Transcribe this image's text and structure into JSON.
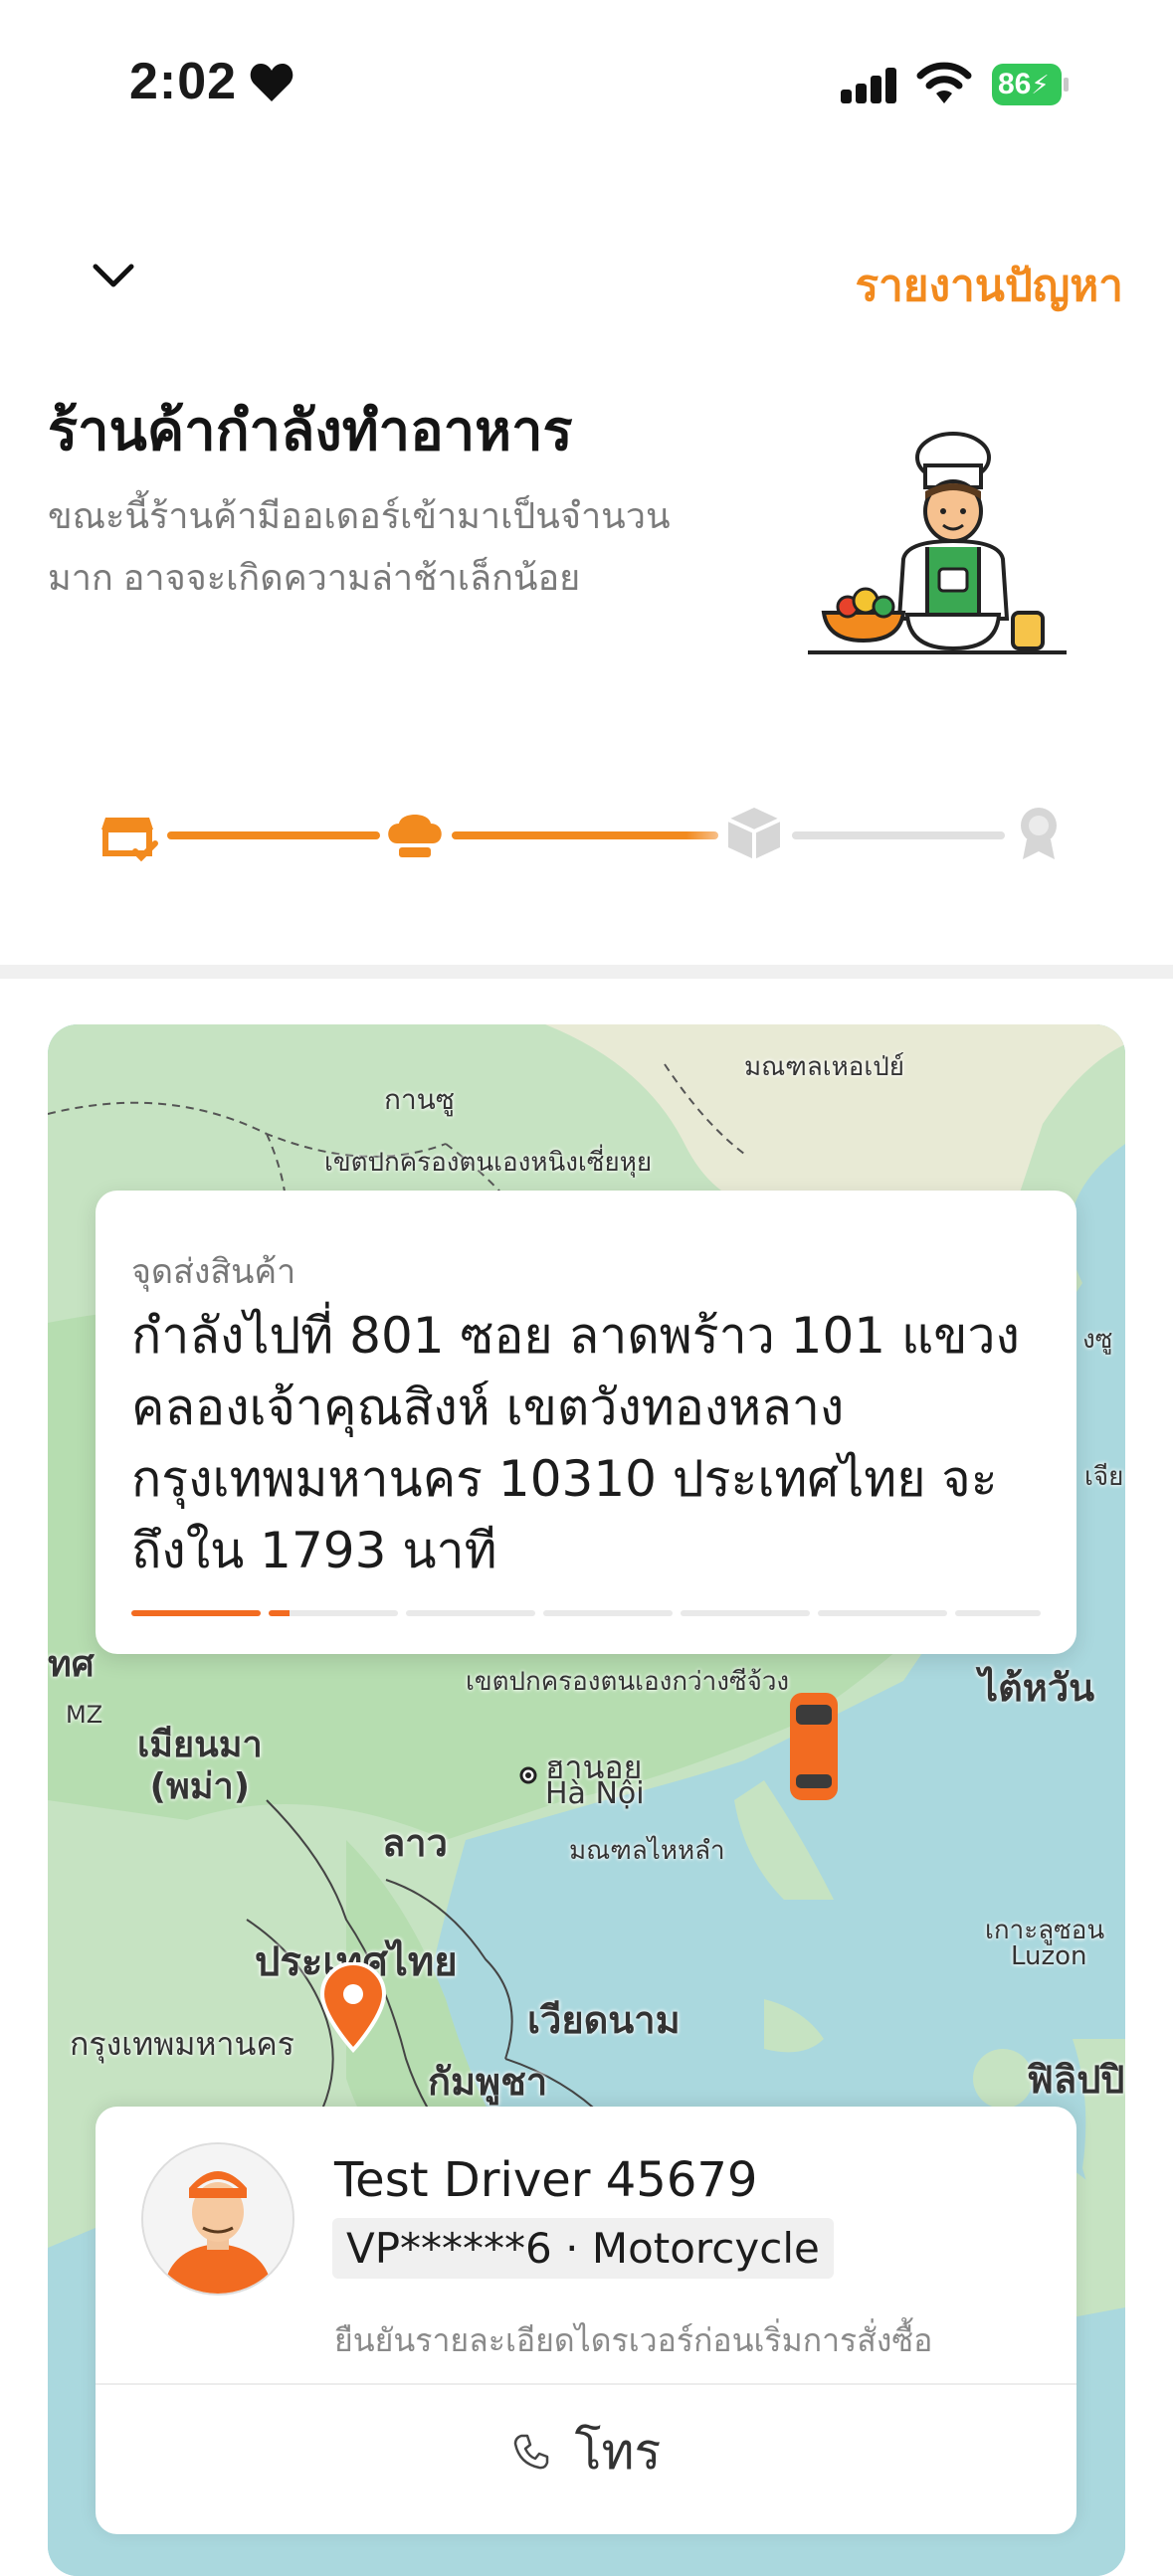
{
  "status_bar": {
    "time": "2:02",
    "battery": "86"
  },
  "header": {
    "report_label": "รายงานปัญหา",
    "title": "ร้านค้ากำลังทำอาหาร",
    "subtitle": "ขณะนี้ร้านค้ามีออเดอร์เข้ามาเป็นจำนวนมาก อาจจะเกิดความล่าช้าเล็กน้อย"
  },
  "progress": {
    "steps": [
      "store-confirmed",
      "cooking",
      "picked-up",
      "delivered"
    ],
    "current_step": 2,
    "accent_color": "#f28a1e",
    "inactive_color": "#d9d9d9"
  },
  "map": {
    "labels": {
      "gansu": "กานซู",
      "mongolia": "มณฑลเหอเป่ย์",
      "ningxia": "เขตปกครองตนเองหนิงเซี่ยหุย",
      "guangxi": "เขตปกครองตนเองกว่างซีจ้วง",
      "taiwan": "ไต้หวัน",
      "myanmar": "เมียนมา\n(พม่า)",
      "hanoi_th": "ฮานอย",
      "hanoi_vi": "Hà Nội",
      "hainan": "มณฑลไหหลำ",
      "laos": "ลาว",
      "thailand": "ประเทศไทย",
      "vietnam": "เวียดนาม",
      "bangkok": "กรุงเทพมหานคร",
      "cambodia": "กัมพูชา",
      "luzon_th": "เกาะลูซอน",
      "luzon_en": "Luzon",
      "philippines": "ฟิลิปปิ",
      "edge_left_1": "ทศ",
      "edge_left_2": "MZ",
      "edge_right_1": "งซู",
      "edge_right_2": "เจีย"
    }
  },
  "destination": {
    "label": "จุดส่งสินค้า",
    "text": "กำลังไปที่ 801 ซอย ลาดพร้าว 101 แขวง คลองเจ้าคุณสิงห์ เขตวังทองหลาง กรุงเทพมหานคร 10310 ประเทศไทย จะถึงใน 1793 นาที",
    "progress_segments_total": 7,
    "progress_active_fraction_of_first": 1.0,
    "progress_second_started": true
  },
  "driver": {
    "name": "Test Driver 45679",
    "plate": "VP******6 · Motorcycle",
    "note": "ยืนยันรายละเอียดไดรเวอร์ก่อนเริ่มการสั่งซื้อ",
    "call_label": "โทร"
  }
}
